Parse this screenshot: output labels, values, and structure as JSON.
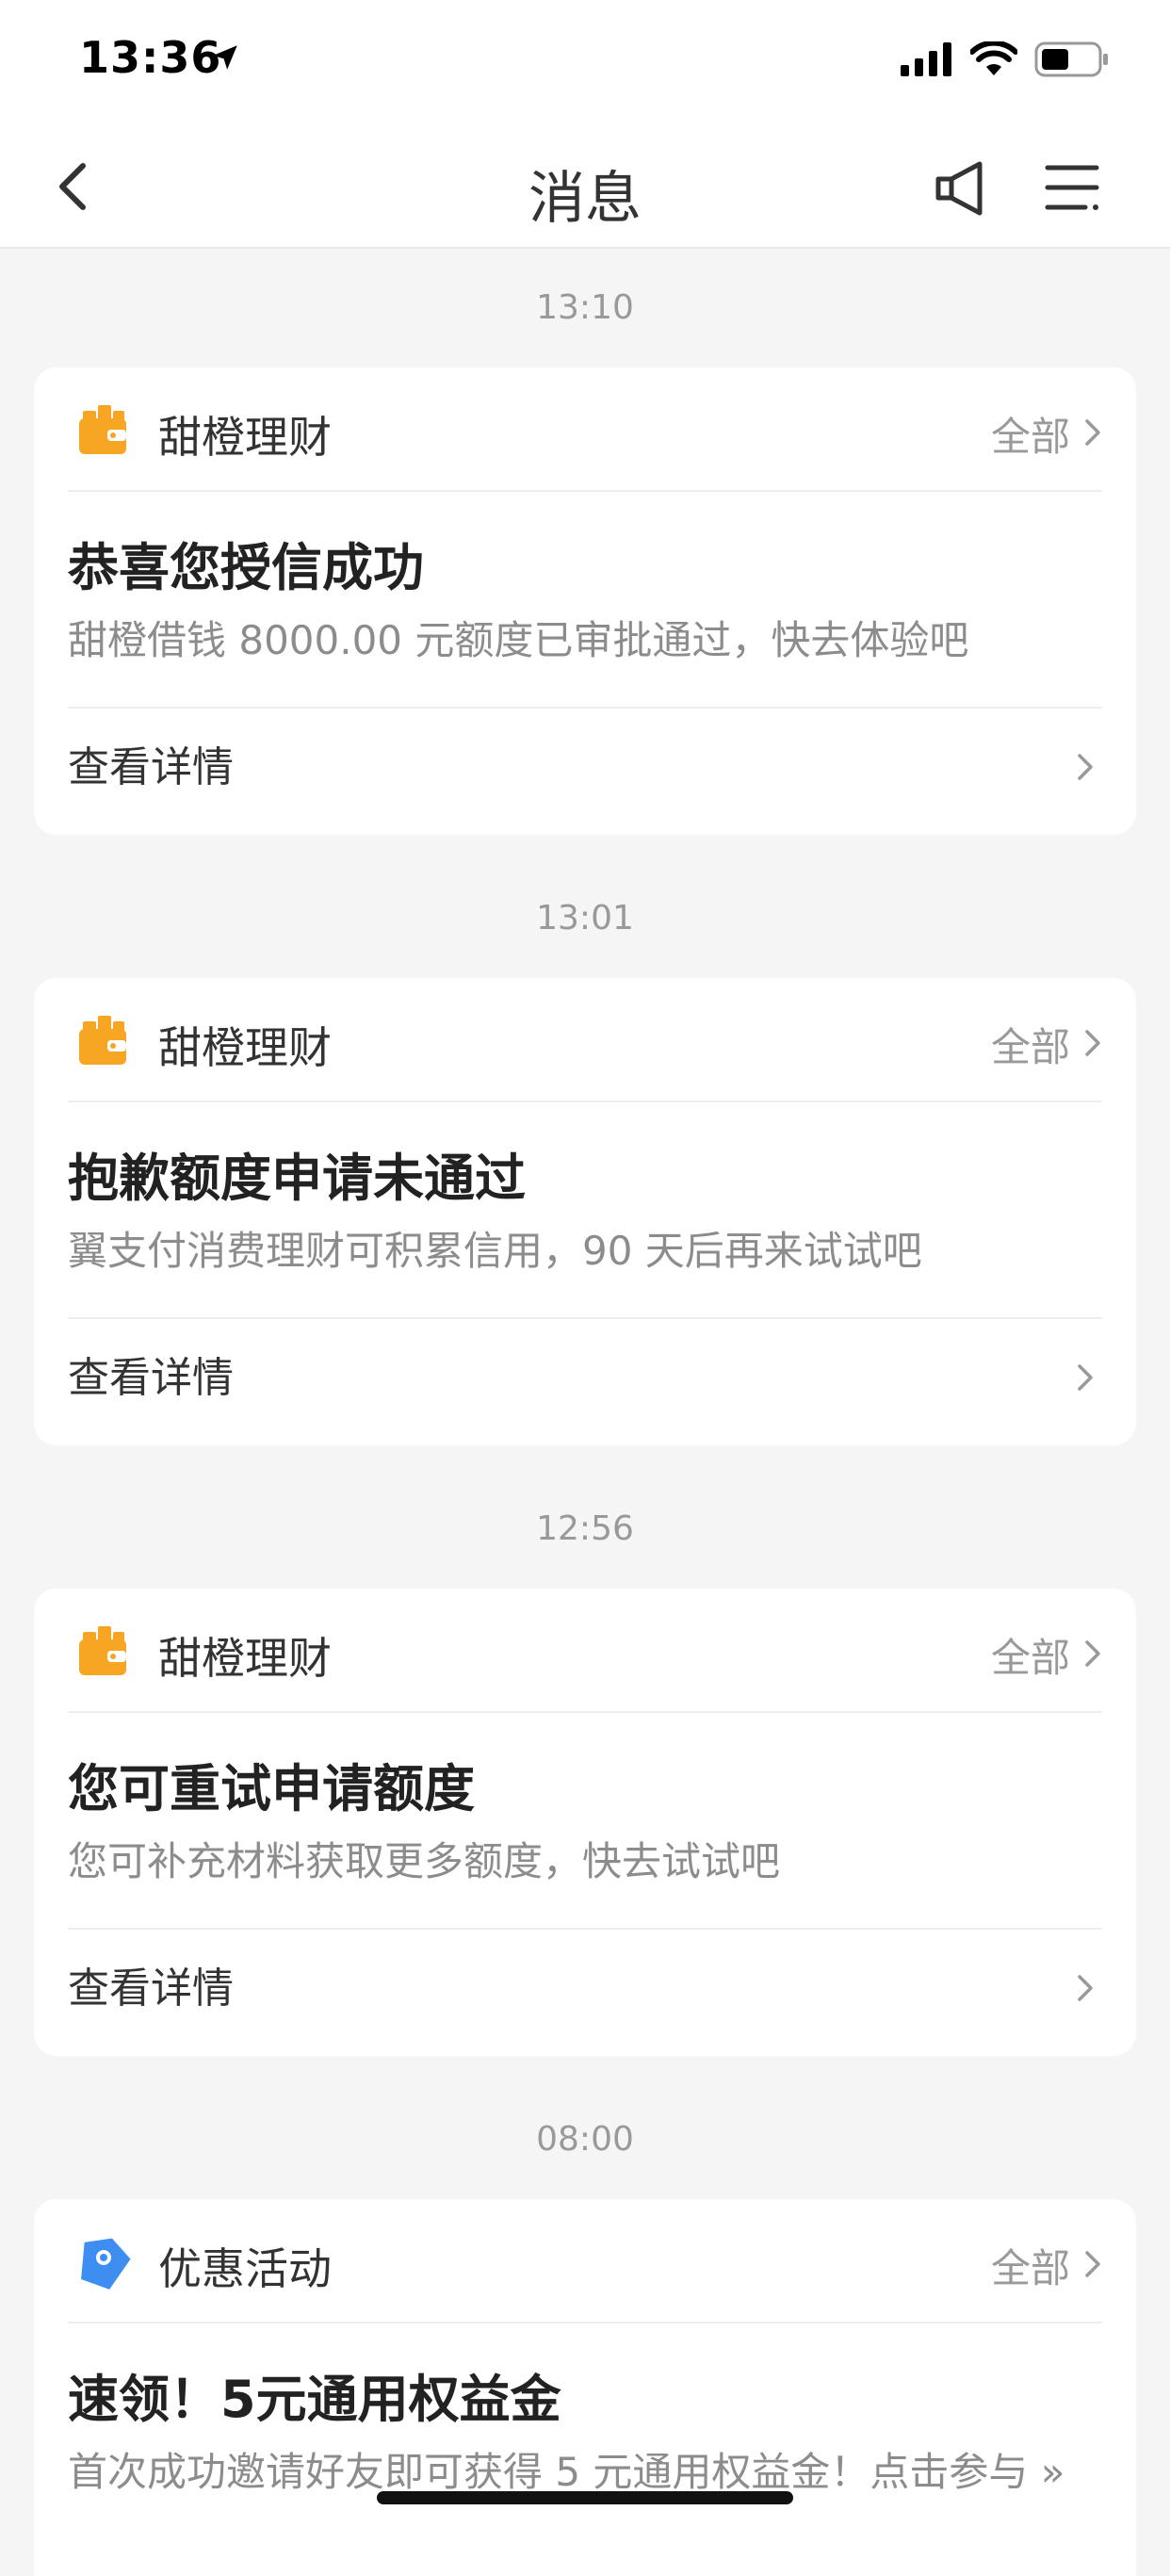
{
  "status_bar": {
    "time": "13:36",
    "icons": [
      "location-arrow-icon",
      "signal-icon",
      "wifi-icon",
      "battery-icon"
    ]
  },
  "nav": {
    "title": "消息",
    "icons": [
      "back-chevron-icon",
      "speaker-icon",
      "menu-icon"
    ]
  },
  "messages": [
    {
      "time": "13:10",
      "source": "甜橙理财",
      "source_icon": "wallet-icon",
      "all_label": "全部",
      "title": "恭喜您授信成功",
      "desc": "甜橙借钱 8000.00 元额度已审批通过，快去体验吧",
      "detail_label": "查看详情"
    },
    {
      "time": "13:01",
      "source": "甜橙理财",
      "source_icon": "wallet-icon",
      "all_label": "全部",
      "title": "抱歉额度申请未通过",
      "desc": "翼支付消费理财可积累信用，90 天后再来试试吧",
      "detail_label": "查看详情"
    },
    {
      "time": "12:56",
      "source": "甜橙理财",
      "source_icon": "wallet-icon",
      "all_label": "全部",
      "title": "您可重试申请额度",
      "desc": "您可补充材料获取更多额度，快去试试吧",
      "detail_label": "查看详情"
    },
    {
      "time": "08:00",
      "source": "优惠活动",
      "source_icon": "tag-icon",
      "all_label": "全部",
      "title": "速领！5元通用权益金",
      "desc": "首次成功邀请好友即可获得 5 元通用权益金！点击参与 »"
    }
  ],
  "colors": {
    "background": "#f5f5f5",
    "card": "#ffffff",
    "wallet_orange": "#f6a623",
    "tag_blue": "#3d8ef0",
    "muted_text": "#999999"
  }
}
